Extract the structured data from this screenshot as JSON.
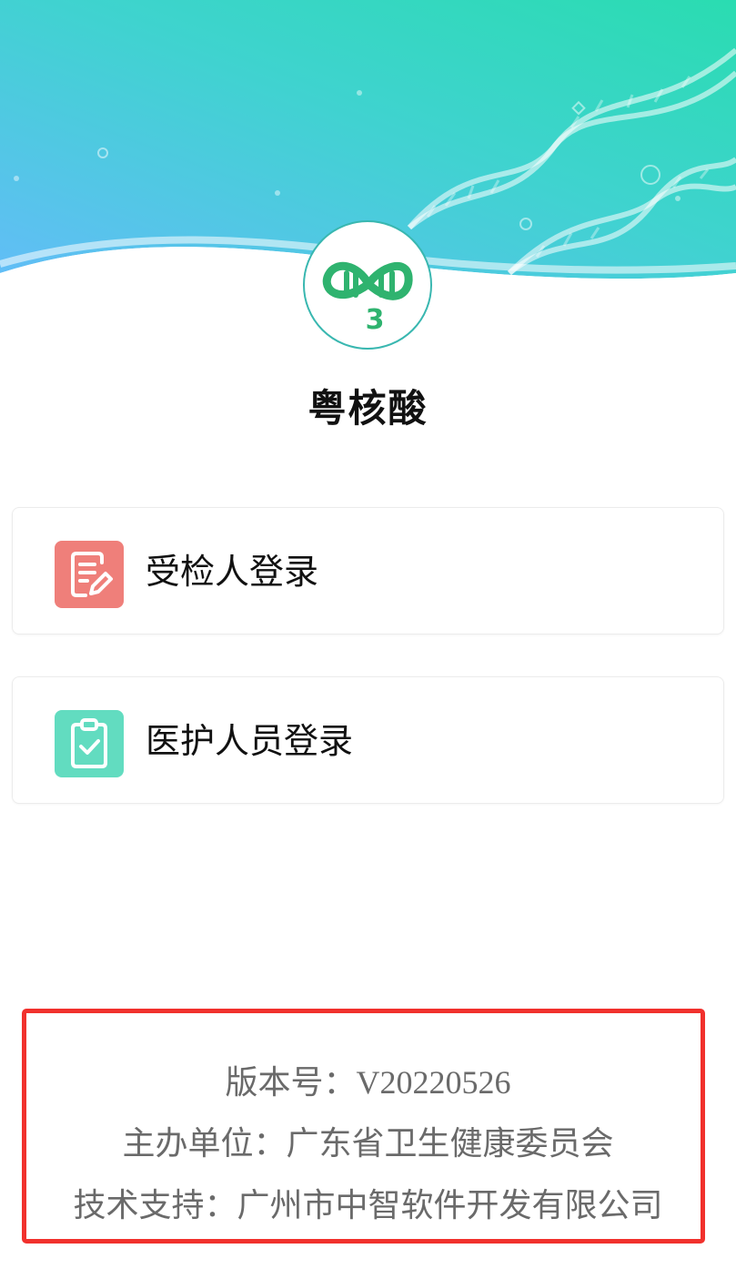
{
  "app": {
    "title": "粤核酸"
  },
  "logo": {
    "icon": "dna-3-logo",
    "number": "3"
  },
  "login_options": [
    {
      "label": "受检人登录",
      "icon": "edit-document-icon",
      "color": "#ef7f7a"
    },
    {
      "label": "医护人员登录",
      "icon": "clipboard-check-icon",
      "color": "#62dcc0"
    }
  ],
  "footer": {
    "version_label": "版本号：",
    "version_value": "V20220526",
    "sponsor": "主办单位：广东省卫生健康委员会",
    "support": "技术支持：广州市中智软件开发有限公司"
  },
  "colors": {
    "header_gradient_start": "#5fbff6",
    "header_gradient_end": "#2ddcb0",
    "highlight_border": "#f1312d"
  }
}
